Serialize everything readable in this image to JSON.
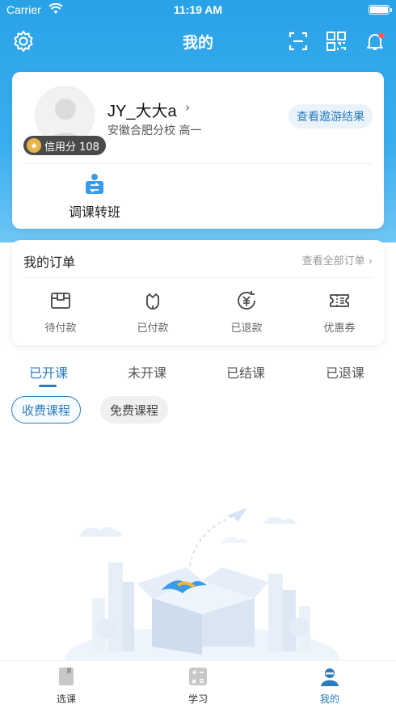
{
  "status_bar": {
    "carrier": "Carrier",
    "time": "11:19 AM"
  },
  "nav": {
    "title": "我的"
  },
  "profile": {
    "name": "JY_大大a",
    "school": "安徽合肥分校  高一",
    "credit": "信用分 108",
    "result_button": "查看遨游结果",
    "transfer_label": "调课转班"
  },
  "orders": {
    "title": "我的订单",
    "view_all": "查看全部订单 ›",
    "items": [
      {
        "label": "待付款",
        "icon": "pending-payment-icon"
      },
      {
        "label": "已付款",
        "icon": "paid-icon"
      },
      {
        "label": "已退款",
        "icon": "refund-icon"
      },
      {
        "label": "优惠券",
        "icon": "coupon-icon"
      }
    ]
  },
  "course_tabs": [
    {
      "label": "已开课"
    },
    {
      "label": "未开课"
    },
    {
      "label": "已结课"
    },
    {
      "label": "已退课"
    }
  ],
  "filters": [
    {
      "label": "收费课程"
    },
    {
      "label": "免费课程"
    }
  ],
  "tabbar": [
    {
      "label": "选课",
      "icon": "course-select-icon"
    },
    {
      "label": "学习",
      "icon": "study-icon"
    },
    {
      "label": "我的",
      "icon": "profile-icon"
    }
  ],
  "colors": {
    "accent": "#2b7bbd",
    "header": "#2aa2e8"
  }
}
